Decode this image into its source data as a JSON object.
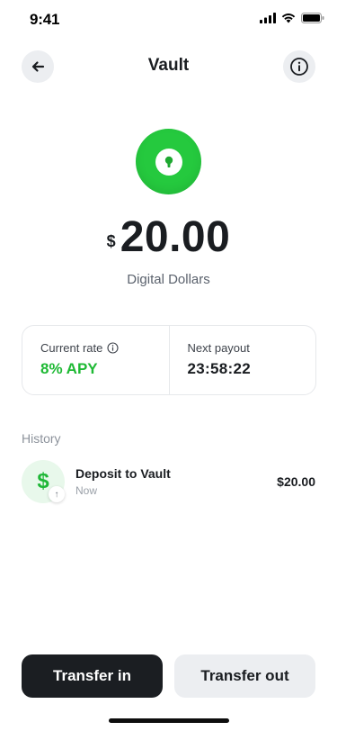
{
  "status": {
    "time": "9:41",
    "icons": [
      "signal-icon",
      "wifi-icon",
      "battery-icon"
    ]
  },
  "nav": {
    "title": "Vault",
    "back_icon": "arrow-left-icon",
    "info_icon": "info-icon"
  },
  "vault": {
    "icon": "lock-icon",
    "accent_color": "#25C93E"
  },
  "balance": {
    "currency_symbol": "$",
    "amount": "20.00",
    "label": "Digital Dollars"
  },
  "rates": {
    "current_rate_label": "Current rate",
    "current_rate_value": "8% APY",
    "next_payout_label": "Next payout",
    "next_payout_value": "23:58:22",
    "positive_color": "#1EB934"
  },
  "history": {
    "title": "History",
    "items": [
      {
        "icon_glyph": "$",
        "badge_glyph": "↑",
        "name": "Deposit to Vault",
        "time": "Now",
        "amount": "$20.00"
      }
    ]
  },
  "actions": {
    "transfer_in": "Transfer in",
    "transfer_out": "Transfer out"
  }
}
